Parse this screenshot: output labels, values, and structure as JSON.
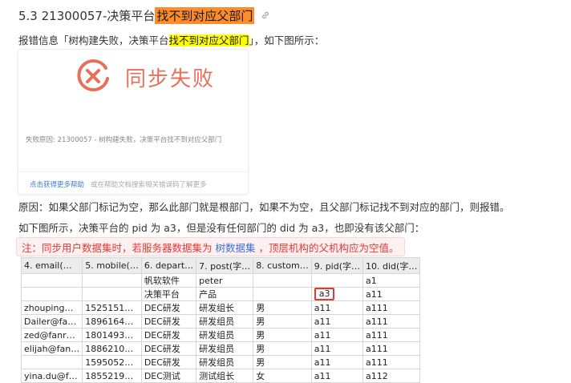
{
  "heading": {
    "number": "5.3 21300057-决策平台",
    "highlight": "找不到对应父部门"
  },
  "paragraphs": {
    "intro_before": "报错信息「树构建失败，决策平台",
    "intro_highlight": "找不到对应父部门",
    "intro_after": "」，如下图所示：",
    "cause": "原因：如果父部门标记为空，那么此部门就是根部门，如果不为空，且父部门标记找不到对应的部门，则报错。",
    "example": "如下图所示，决策平台的 pid 为 a3，但是没有任何部门的 did 为 a3，也即没有该父部门："
  },
  "card": {
    "title": "同步失败",
    "reason": "失败原因: 21300057 - 树构建失败，决策平台找不到对应父部门",
    "link": "点击获得更多帮助",
    "hint": "或在帮助文档搜索相关错误码了解更多"
  },
  "note": {
    "before": "注：同步用户数据集时，若服务器数据集为",
    "link": "树数据集",
    "after": "，顶层机构的父机构应为空值。"
  },
  "table": {
    "headers": [
      "4. email(…",
      "5. mobile(…",
      "6. depart…",
      "7. post(字…",
      "8. custom…",
      "9. pid(字…",
      "10. did(字…"
    ],
    "rows": [
      [
        "",
        "",
        "帆软软件",
        "peter",
        "",
        "",
        "a1"
      ],
      [
        "",
        "",
        "决策平台",
        "产品",
        "",
        "a3",
        "a11"
      ],
      [
        "zhouping…",
        "1525151…",
        "DEC研发",
        "研发组长",
        "男",
        "a11",
        "a111"
      ],
      [
        "Dailer@fa…",
        "1896164…",
        "DEC研发",
        "研发组员",
        "男",
        "a11",
        "a111"
      ],
      [
        "zed@fanr…",
        "1801493…",
        "DEC研发",
        "研发组员",
        "男",
        "a11",
        "a111"
      ],
      [
        "elijah@fan…",
        "1886210…",
        "DEC研发",
        "研发组员",
        "男",
        "a11",
        "a111"
      ],
      [
        "",
        "1595052…",
        "DEC研发",
        "研发组员",
        "男",
        "a11",
        "a111"
      ],
      [
        "yina.du@f…",
        "1855219…",
        "DEC测试",
        "测试组长",
        "女",
        "a11",
        "a112"
      ]
    ]
  },
  "colors": {
    "orange_highlight": "#ff8c2a",
    "yellow_highlight": "#ffff00",
    "error_red": "#e53935",
    "link_blue": "#3b6fd6"
  }
}
